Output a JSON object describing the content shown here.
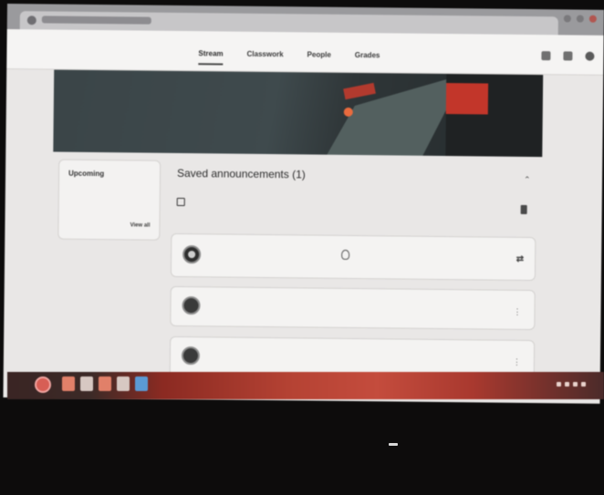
{
  "browser": {
    "tab_title": "",
    "window_controls": [
      "minimize-icon",
      "maximize-icon",
      "close-icon"
    ]
  },
  "header": {
    "class_name": "",
    "nav_tabs": [
      {
        "label": "Stream",
        "active": true
      },
      {
        "label": "Classwork",
        "active": false
      },
      {
        "label": "People",
        "active": false
      },
      {
        "label": "Grades",
        "active": false
      }
    ],
    "icons": [
      "settings-icon",
      "apps-icon",
      "account-icon"
    ]
  },
  "banner": {
    "title": "",
    "theme_link": ""
  },
  "upcoming": {
    "title": "Upcoming",
    "text": "",
    "view_all": "View all"
  },
  "stream": {
    "saved_title": "Saved announcements (1)",
    "saved_item": {
      "text": "",
      "date": ""
    },
    "compose_placeholder": "",
    "posts": [
      {
        "title": "",
        "date": ""
      },
      {
        "title": "",
        "date": ""
      }
    ]
  },
  "colors": {
    "taskbar_accent": "#b64334",
    "banner_accent": "#c2362a"
  }
}
